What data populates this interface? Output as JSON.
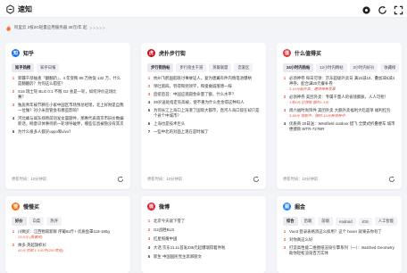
{
  "app": {
    "title": "速知",
    "icons": [
      "settings-icon",
      "refresh-icon",
      "fullscreen-icon"
    ]
  },
  "notice": {
    "text": "阿里云 2核2G轻量应用服务器 38元/年 起",
    "arrows": ">>>>>"
  },
  "cards": {
    "zhihu": {
      "title": "知乎",
      "tabs": [
        "知乎热榜",
        "知乎日报"
      ],
      "items": [
        {
          "num": "1",
          "text": "新疆干部抽查「翻翻药」，4 年受贿 95 万依饭 132 万，什么是翻翻药？为何这么猖狂？"
        },
        {
          "num": "2",
          "text": "S15 瑞士轮 BLG 0:1 不敌 G2 会是一轮，如何评价这场比赛？"
        },
        {
          "num": "3",
          "text": "独居青年被节脾在小家中国区市场预总经理，北上好财是自我一位做？对小米直管会有哪些影响？"
        },
        {
          "num": "4",
          "text": "河北峰与阎东郑原前别发女晨题件，那惠代表南京市旧价数编新话，网意识体事待新一轮领导破界，哪些信息被隐没有其次"
        },
        {
          "num": "5",
          "text": "为什么很多人都买oppo和vivo？"
        }
      ],
      "updated": "更新时间：10分钟前"
    },
    "hupu": {
      "title": "虎扑步行街",
      "tabs": [
        "步行街热帖",
        "步行街主干道",
        "英雄联盟",
        "恋爱区"
      ],
      "items": [
        {
          "num": "1",
          "text": "杭州飞鹤国航跌讨事故证人，复为唐翼有件内情电池爆柄"
        },
        {
          "num": "2",
          "text": "单吐第四，罚得和到领学，和俊做诚落博一辞"
        },
        {
          "num": "3",
          "text": "后疫后首：中国应现圆金命量了额，什么水平？"
        },
        {
          "num": "4",
          "text": "39岁送处指定有高被，使不重为什么金金得这种吗人"
        },
        {
          "num": "5",
          "text": "为何长江上海口上海港了国际大都市，直河人海口现在却只是个县个中城市？"
        },
        {
          "num": "6",
          "text": "上海也是技术巨头"
        },
        {
          "num": "7",
          "text": "一些中北的对面上现在是时候了"
        }
      ],
      "updated": "更新时间：10分钟前"
    },
    "smzdm": {
      "title": "什么值得买",
      "tabs": [
        "24小时内热帖",
        "12小时内精帖",
        "3小时内好价",
        "收藏榜"
      ],
      "items": [
        {
          "num": "1",
          "text": "必领神券 每日可领：京东超级外卖日 满15减10、叠加减5减4神券，配合满20元餐补券",
          "sub": "3.16元起外卖，速领神券发票"
        },
        {
          "num": "2",
          "text": "必领神券 美团外卖：专属千量人的省钱膨胀，人人可抢！",
          "sub": "1毛8元 已领取 额外1.3元"
        },
        {
          "num": "3",
          "text": "周六福时尚饰件 美团外卖 大额外卖福利大吃超单 福利红包",
          "sub": "3.58元 领取中，限时-10元券领券中"
        },
        {
          "num": "4",
          "text": "优质商 20日送：Westfield outdoor 猎飞 全樊式折叠便车 城市便捷款 WTR-727BR",
          "sub": ""
        }
      ],
      "updated": "更新时间：10分钟前"
    },
    "tieba": {
      "title": "慢慢买",
      "tabs": [
        "好价",
        "白菜",
        "热评"
      ],
      "items": [
        {
          "num": "1",
          "text": "川赐买：江西物南新鲜 序葡92斤+ 优质鱼罩118-180g",
          "sub": "25.8元 (需要买)"
        },
        {
          "num": "2",
          "text": "帅多 英超旗帜衫",
          "sub": "45元 包邮 1.5元/件(200克选)"
        }
      ]
    },
    "weibo": {
      "title": "微博",
      "items": [
        {
          "num": "1",
          "text": "北京今天就下雪了"
        },
        {
          "num": "2",
          "text": "G2战胜BLG"
        },
        {
          "num": "3",
          "text": "红星照耀中国"
        },
        {
          "num": "4",
          "text": "大话 京东11.11首发235元起爆瑞得着件啦"
        },
        {
          "num": "5",
          "text": "新生 中国国民党主席郑丽文"
        }
      ]
    },
    "juejin": {
      "title": "掘金",
      "tabs": [
        "综合",
        "后端",
        "前端",
        "Android",
        "iOS",
        "人工智能"
      ],
      "items": [
        {
          "num": "1",
          "text": "Vue3 登录表格消这么样用？这个 hover 就果去你有了"
        },
        {
          "num": "2",
          "text": "对你真这么好"
        },
        {
          "num": "3",
          "text": "打造高性能二维图纸渲染引擎系列（一）：Batched Geometry 助你轻松渲染百万实体"
        }
      ]
    }
  }
}
